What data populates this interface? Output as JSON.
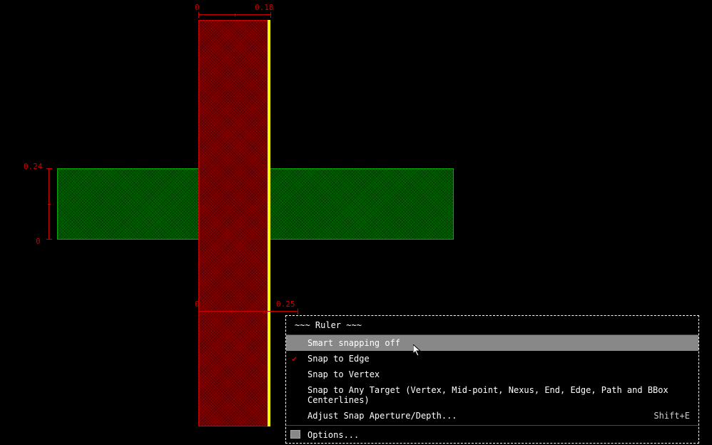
{
  "rulers": {
    "top": {
      "start": "0",
      "end": "0.18"
    },
    "left": {
      "start": "0",
      "end": "0.24"
    },
    "bottom": {
      "start": "0",
      "end": "0.25"
    }
  },
  "menu": {
    "header": "~~~ Ruler ~~~",
    "items": [
      {
        "label": "Smart snapping off",
        "checked": false,
        "highlighted": true,
        "shortcut": ""
      },
      {
        "label": "Snap to Edge",
        "checked": true,
        "highlighted": false,
        "shortcut": ""
      },
      {
        "label": "Snap to Vertex",
        "checked": false,
        "highlighted": false,
        "shortcut": ""
      },
      {
        "label": "Snap to Any Target (Vertex, Mid-point, Nexus, End, Edge, Path and BBox Centerlines)",
        "checked": false,
        "highlighted": false,
        "shortcut": ""
      },
      {
        "label": "Adjust Snap Aperture/Depth...",
        "checked": false,
        "highlighted": false,
        "shortcut": "Shift+E"
      }
    ],
    "options_label": "Options..."
  }
}
